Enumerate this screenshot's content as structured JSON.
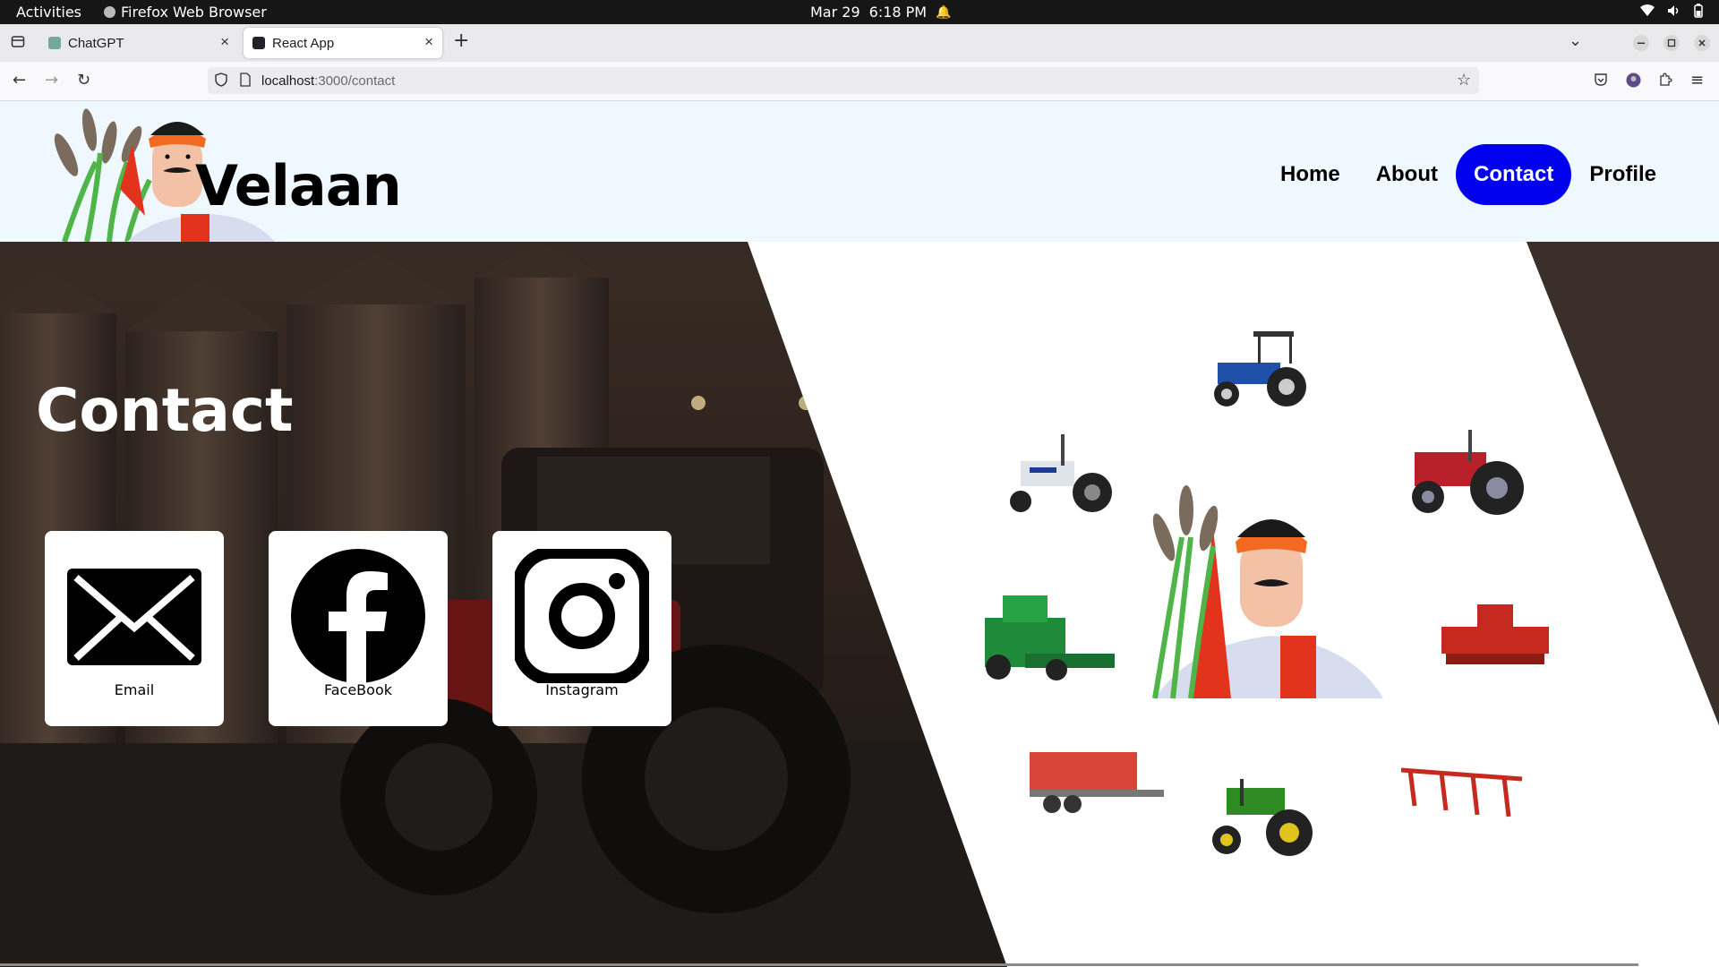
{
  "system": {
    "activities": "Activities",
    "app_name": "Firefox Web Browser",
    "date": "Mar 29",
    "time": "6:18 PM"
  },
  "browser": {
    "tabs": [
      {
        "label": "ChatGPT",
        "active": false
      },
      {
        "label": "React App",
        "active": true
      }
    ],
    "url_host": "localhost",
    "url_path": ":3000/contact"
  },
  "site": {
    "brand": "Velaan",
    "nav": [
      {
        "label": "Home",
        "active": false
      },
      {
        "label": "About",
        "active": false
      },
      {
        "label": "Contact",
        "active": true
      },
      {
        "label": "Profile",
        "active": false
      }
    ],
    "accent_color": "#0000ee",
    "header_bg": "#eff8ff"
  },
  "contact": {
    "title": "Contact",
    "cards": [
      {
        "label": "Email",
        "icon": "envelope-icon"
      },
      {
        "label": "FaceBook",
        "icon": "facebook-icon"
      },
      {
        "label": "Instagram",
        "icon": "instagram-icon"
      }
    ]
  }
}
